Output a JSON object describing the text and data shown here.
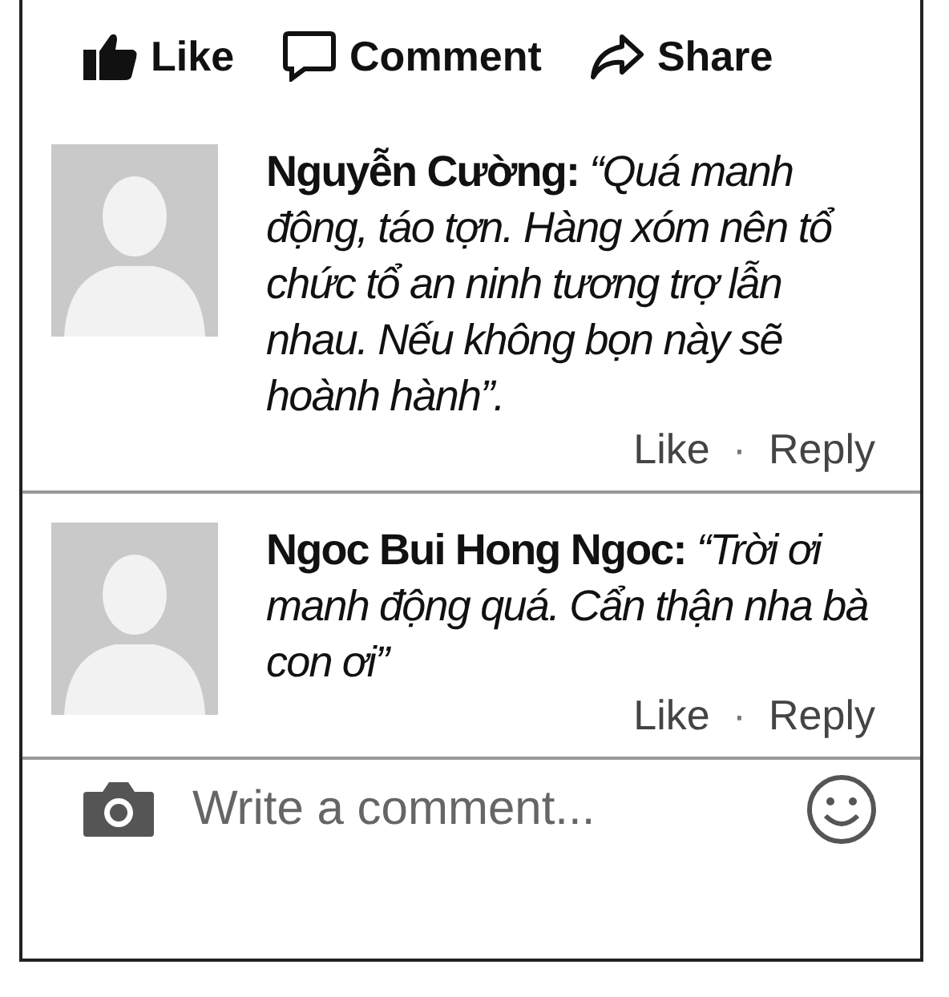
{
  "actions": [
    {
      "kind": "like",
      "label": "Like"
    },
    {
      "kind": "comment",
      "label": "Comment"
    },
    {
      "kind": "share",
      "label": "Share"
    }
  ],
  "comments": [
    {
      "author": "Nguyễn Cường:",
      "text": "“Quá manh động, táo tợn. Hàng xóm nên tổ chức tổ an ninh tương trợ lẫn nhau. Nếu không bọn này sẽ hoành hành”.",
      "like": "Like",
      "separator": "·",
      "reply": "Reply"
    },
    {
      "author": "Ngoc Bui Hong Ngoc:",
      "text": "“Trời ơi manh động quá. Cẩn thận nha bà con ơi”",
      "like": "Like",
      "separator": "·",
      "reply": "Reply"
    }
  ],
  "composer": {
    "placeholder": "Write a comment..."
  }
}
